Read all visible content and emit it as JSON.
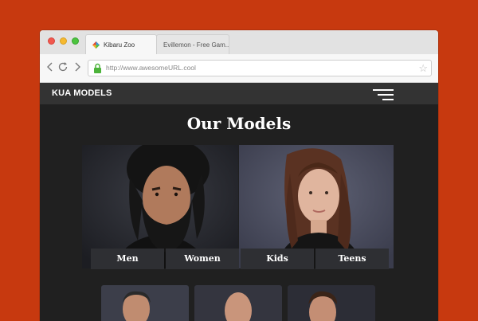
{
  "browser": {
    "tabs": [
      {
        "label": "Kibaru Zoo",
        "active": true
      },
      {
        "label": "Evillemon - Free Gam...",
        "active": false
      }
    ],
    "url": "http://www.awesomeURL.cool"
  },
  "site": {
    "brand": "KUA MODELS",
    "title": "Our Models",
    "categories": [
      "Men",
      "Women",
      "Kids",
      "Teens"
    ]
  },
  "colors": {
    "background": "#c7390f",
    "site_bg": "#202020",
    "nav_bg": "#333333",
    "category_bg": "#2e2f33"
  },
  "icons": [
    "back-arrow-icon",
    "reload-icon",
    "forward-arrow-icon",
    "lock-icon",
    "bookmark-star-icon",
    "hamburger-menu-icon"
  ]
}
